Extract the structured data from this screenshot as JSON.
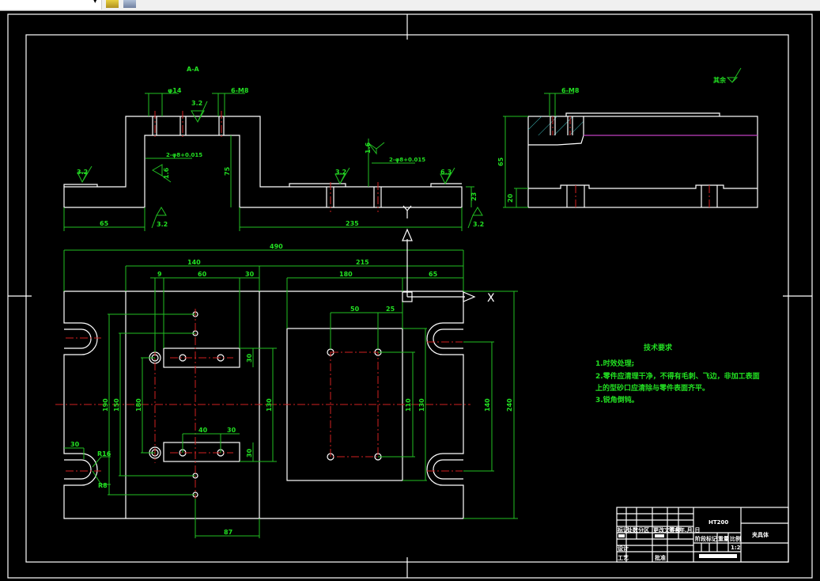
{
  "toolbar": {
    "dropdown_arrow": "▾",
    "icons": [
      "layer-yellow-icon",
      "layer-gray-icon"
    ]
  },
  "section": {
    "label": "A-A",
    "dims": [
      "φ14",
      "6-M8",
      "2-φ8+0.015",
      "75",
      "65",
      "235",
      "2-φ8+0.015",
      "23"
    ],
    "roughness": [
      "3.2",
      "3.2",
      "1.6",
      "3.2",
      "3.2",
      "1.6",
      "6.3",
      "3.2"
    ]
  },
  "side_view": {
    "dims": [
      "65",
      "20",
      "6-M8"
    ],
    "other_roughness": "其余"
  },
  "plan_view": {
    "dims": [
      "490",
      "140",
      "215",
      "9",
      "60",
      "30",
      "180",
      "65",
      "50",
      "25",
      "190",
      "150",
      "180",
      "30",
      "130",
      "40",
      "30",
      "30",
      "110",
      "130",
      "140",
      "240",
      "30",
      "R16",
      "R8",
      "87"
    ],
    "axis_x": "X",
    "axis_y": "Y"
  },
  "tech_requirements": {
    "title": "技术要求",
    "lines": [
      "1.时效处理;",
      "2.零件应清理干净，不得有毛刺、飞边，非加工表面",
      "上的型砂口应清除与零件表面齐平。",
      "3.锐角倒钝。"
    ]
  },
  "title_block": {
    "material": "HT200",
    "part_name": "夹具体",
    "headers": [
      "标记",
      "处数",
      "分区",
      "更改文件号",
      "签名",
      "年.月.日"
    ],
    "stage_headers": [
      "阶段标记",
      "重量",
      "比例"
    ],
    "scale": "1:2",
    "roles": [
      "设计",
      "工艺",
      "批准"
    ]
  },
  "colors": {
    "outline": "#ffffff",
    "dimension": "#22e022",
    "centerline": "#d02020",
    "hatch": "#40c0c0",
    "background": "#000000"
  }
}
